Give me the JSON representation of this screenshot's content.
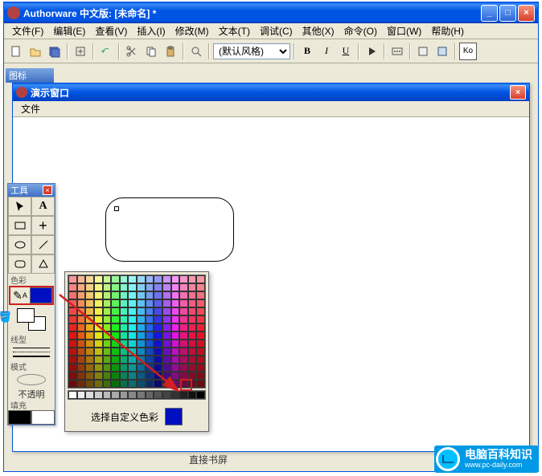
{
  "main_window": {
    "title": "Authorware 中文版: [未命名] *",
    "min_label": "_",
    "max_label": "□",
    "close_label": "×"
  },
  "menubar": {
    "items": [
      "文件(F)",
      "编辑(E)",
      "查看(V)",
      "插入(I)",
      "修改(M)",
      "文本(T)",
      "调试(C)",
      "其他(X)",
      "命令(O)",
      "窗口(W)",
      "帮助(H)"
    ]
  },
  "toolbar": {
    "style_select": "(默认风格)",
    "bold": "B",
    "italic": "I",
    "underline": "U",
    "ko": "Ko"
  },
  "icon_panel": {
    "title": "图标"
  },
  "presentation_window": {
    "title": "演示窗口",
    "close_label": "×",
    "menu_file": "文件"
  },
  "tools_palette": {
    "title": "工具",
    "close_label": "×",
    "section_color": "色彩",
    "section_line": "线型",
    "section_mode": "模式",
    "mode_value": "不透明",
    "section_fill": "填充",
    "text_tool": "A",
    "plus_tool": "+"
  },
  "color_popup": {
    "custom_label": "选择自定义色彩",
    "selected_color": "#0010c0"
  },
  "watermark": {
    "title": "电脑百科知识",
    "url": "www.pc-daily.com"
  },
  "status": "直接书屏"
}
